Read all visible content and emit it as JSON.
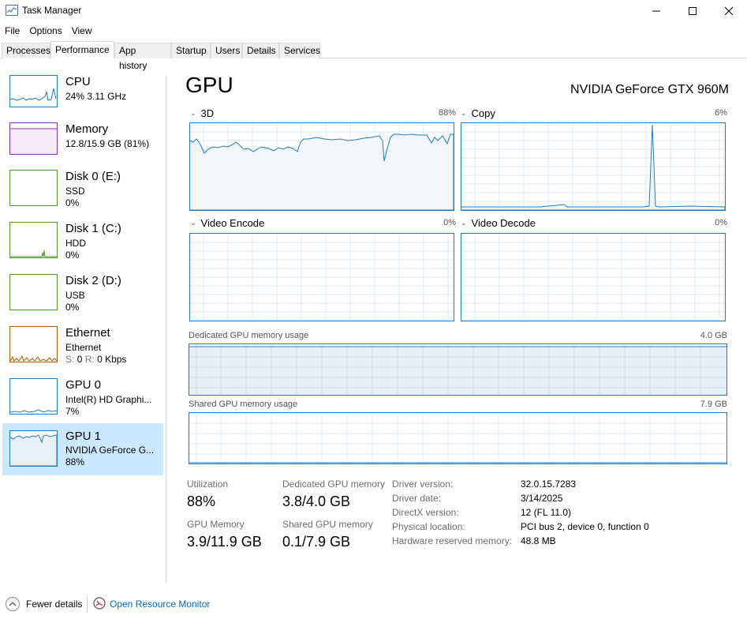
{
  "window": {
    "title": "Task Manager"
  },
  "menu": [
    "File",
    "Options",
    "View"
  ],
  "tabs": [
    "Processes",
    "Performance",
    "App history",
    "Startup",
    "Users",
    "Details",
    "Services"
  ],
  "active_tab": "Performance",
  "sidebar": {
    "items": [
      {
        "name": "CPU",
        "sub1": "24%  3.11 GHz",
        "sub2": "",
        "color": "#1f7ac5"
      },
      {
        "name": "Memory",
        "sub1": "12.8/15.9 GB (81%)",
        "sub2": "",
        "color": "#8b2fb1"
      },
      {
        "name": "Disk 0 (E:)",
        "sub1": "SSD",
        "sub2": "0%",
        "color": "#4c9a2a"
      },
      {
        "name": "Disk 1 (C:)",
        "sub1": "HDD",
        "sub2": "0%",
        "color": "#4c9a2a"
      },
      {
        "name": "Disk 2 (D:)",
        "sub1": "USB",
        "sub2": "0%",
        "color": "#4c9a2a"
      },
      {
        "name": "Ethernet",
        "sub1": "Ethernet",
        "sub2_s_label": "S:",
        "sub2_s": "0",
        "sub2_r_label": "R:",
        "sub2_r": "0 Kbps",
        "color": "#a75d0a"
      },
      {
        "name": "GPU 0",
        "sub1": "Intel(R) HD Graphi...",
        "sub2": "7%",
        "color": "#1f7ac5"
      },
      {
        "name": "GPU 1",
        "sub1": "NVIDIA GeForce G...",
        "sub2": "88%",
        "color": "#1f7ac5"
      }
    ],
    "selected_index": 7
  },
  "main": {
    "title": "GPU",
    "model": "NVIDIA GeForce GTX 960M",
    "engines": [
      {
        "label": "3D",
        "pct": "88%"
      },
      {
        "label": "Copy",
        "pct": "6%"
      },
      {
        "label": "Video Encode",
        "pct": "0%"
      },
      {
        "label": "Video Decode",
        "pct": "0%"
      }
    ],
    "dedicated_label": "Dedicated GPU memory usage",
    "dedicated_max": "4.0 GB",
    "shared_label": "Shared GPU memory usage",
    "shared_max": "7.9 GB"
  },
  "stats": {
    "utilization_label": "Utilization",
    "utilization": "88%",
    "dedicated_label": "Dedicated GPU memory",
    "dedicated": "3.8/4.0 GB",
    "gpu_memory_label": "GPU Memory",
    "gpu_memory": "3.9/11.9 GB",
    "shared_label": "Shared GPU memory",
    "shared": "0.1/7.9 GB"
  },
  "info": [
    {
      "k": "Driver version:",
      "v": "32.0.15.7283"
    },
    {
      "k": "Driver date:",
      "v": "3/14/2025"
    },
    {
      "k": "DirectX version:",
      "v": "12 (FL 11.0)"
    },
    {
      "k": "Physical location:",
      "v": "PCI bus 2, device 0, function 0"
    },
    {
      "k": "Hardware reserved memory:",
      "v": "48.8 MB"
    }
  ],
  "footer": {
    "fewer_details": "Fewer details",
    "open_resource_monitor": "Open Resource Monitor"
  },
  "colors": {
    "gpu_line": "#1f7ac5",
    "gpu_fill": "#f1f6fb",
    "grid": "#dcebf5",
    "selected_bg": "#cce8ff",
    "link": "#0066cc"
  }
}
